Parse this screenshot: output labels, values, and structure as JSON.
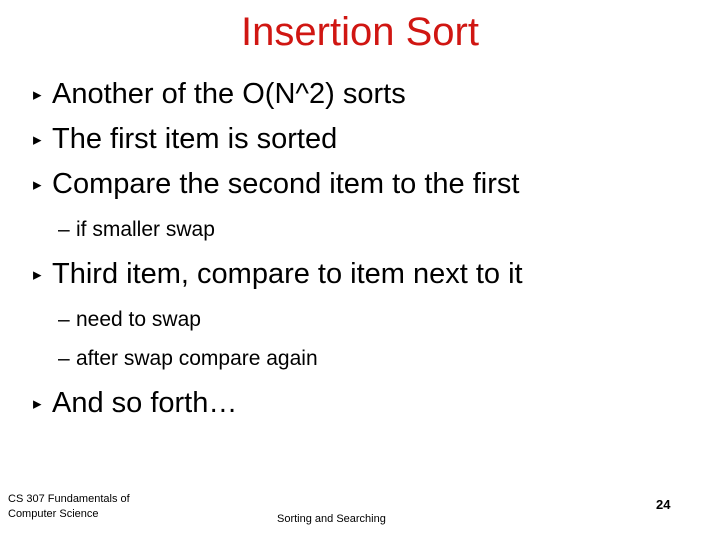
{
  "slide": {
    "title": "Insertion Sort",
    "title_color": "#d01612",
    "background_color": "#ffffff",
    "text_color": "#000000",
    "bullet_marker": "▸",
    "sub_bullet_marker": "–",
    "content": [
      {
        "level": 1,
        "text": "Another of the O(N^2) sorts"
      },
      {
        "level": 1,
        "text": "The first item is sorted"
      },
      {
        "level": 1,
        "text": "Compare the second item to the first"
      },
      {
        "level": 2,
        "text": "if smaller swap"
      },
      {
        "level": 1,
        "text": "Third item, compare to item next to it"
      },
      {
        "level": 2,
        "text": "need to swap"
      },
      {
        "level": 2,
        "text": "after swap compare again"
      },
      {
        "level": 1,
        "text": "And so forth…"
      }
    ]
  },
  "footer": {
    "course": "CS 307 Fundamentals of\nComputer Science",
    "topic": "Sorting and Searching",
    "page_number": "24"
  }
}
